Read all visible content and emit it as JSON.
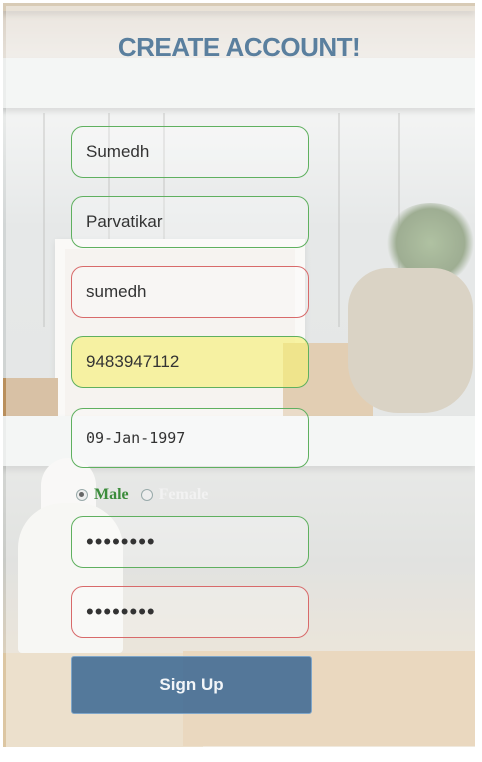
{
  "form": {
    "title": "CREATE ACCOUNT!",
    "first_name": "Sumedh",
    "last_name": "Parvatikar",
    "username": "sumedh",
    "phone": "9483947112",
    "dob": "09-Jan-1997",
    "gender": {
      "selected": "Male",
      "options": [
        "Male",
        "Female"
      ]
    },
    "password": "••••••••",
    "confirm_password": "••••••••",
    "submit_label": "Sign Up"
  },
  "colors": {
    "valid_border": "#5fb05f",
    "invalid_border": "#d86a6a",
    "title": "#5a7f9e",
    "button": "#3a6692",
    "phone_highlight": "#f6f078"
  }
}
